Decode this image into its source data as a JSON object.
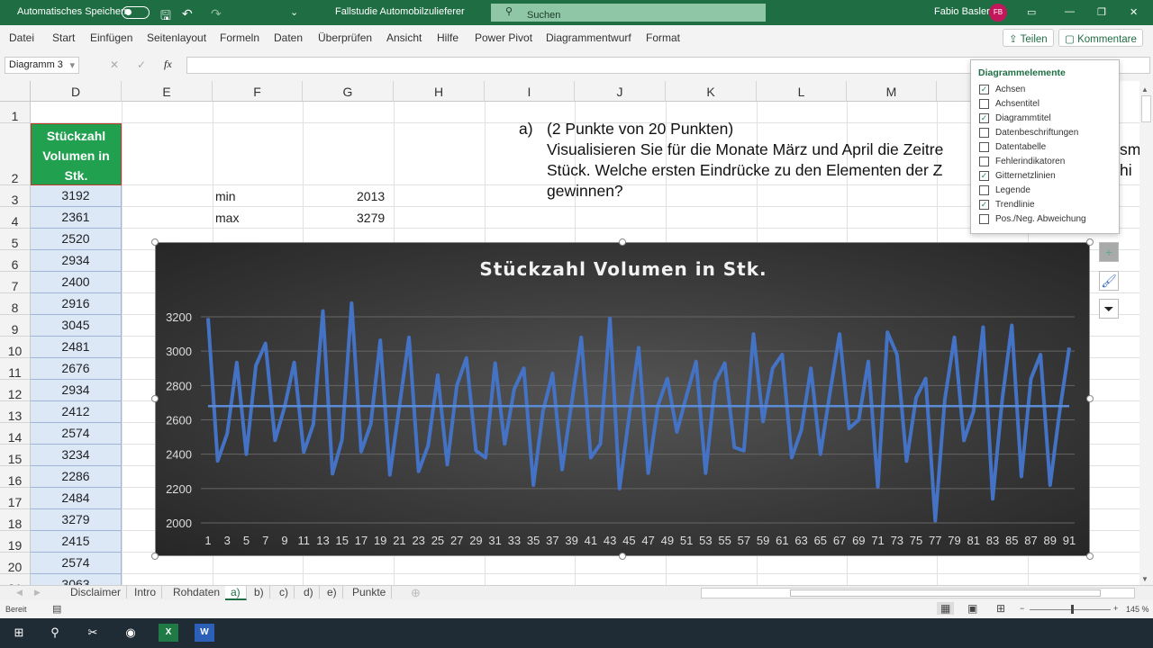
{
  "titlebar": {
    "autosave": "Automatisches Speichern",
    "filename": "Fallstudie Automobilzulieferer",
    "search_placeholder": "Suchen",
    "user": "Fabio Basler",
    "user_initials": "FB"
  },
  "menu": {
    "items": [
      "Datei",
      "Start",
      "Einfügen",
      "Seitenlayout",
      "Formeln",
      "Daten",
      "Überprüfen",
      "Ansicht",
      "Hilfe",
      "Power Pivot",
      "Diagrammentwurf",
      "Format"
    ],
    "share": "Teilen",
    "comments": "Kommentare"
  },
  "formula_bar": {
    "name_box": "Diagramm 3",
    "fx": "fx",
    "value": ""
  },
  "columns": [
    "D",
    "E",
    "F",
    "G",
    "H",
    "I",
    "J",
    "K",
    "L",
    "M",
    "N"
  ],
  "rows": [
    "1",
    "2",
    "3",
    "4",
    "5",
    "6",
    "7",
    "8",
    "9",
    "10",
    "11",
    "12",
    "13",
    "14",
    "15",
    "16",
    "17",
    "18",
    "19",
    "20",
    "21"
  ],
  "column_d": {
    "header": "Stückzahl Volumen in Stk.",
    "values": [
      "3192",
      "2361",
      "2520",
      "2934",
      "2400",
      "2916",
      "3045",
      "2481",
      "2676",
      "2934",
      "2412",
      "2574",
      "3234",
      "2286",
      "2484",
      "3279",
      "2415",
      "2574",
      "3063"
    ]
  },
  "stats": {
    "min_label": "min",
    "min_value": "2013",
    "max_label": "max",
    "max_value": "3279"
  },
  "task": {
    "label": "a)",
    "line1": "(2 Punkte von 20 Punkten)",
    "line2": "Visualisieren Sie für die Monate März und April die Zeitre",
    "line2_end": "sm",
    "line3": "Stück. Welche ersten Eindrücke zu den Elementen der Z",
    "line3_end": "hi",
    "line4": "gewinnen?"
  },
  "chart_elements": {
    "title": "Diagrammelemente",
    "items": [
      {
        "label": "Achsen",
        "checked": true
      },
      {
        "label": "Achsentitel",
        "checked": false
      },
      {
        "label": "Diagrammtitel",
        "checked": true
      },
      {
        "label": "Datenbeschriftungen",
        "checked": false
      },
      {
        "label": "Datentabelle",
        "checked": false
      },
      {
        "label": "Fehlerindikatoren",
        "checked": false
      },
      {
        "label": "Gitternetzlinien",
        "checked": true
      },
      {
        "label": "Legende",
        "checked": false
      },
      {
        "label": "Trendlinie",
        "checked": true
      },
      {
        "label": "Pos./Neg. Abweichung",
        "checked": false
      }
    ]
  },
  "chart_data": {
    "type": "line",
    "title": "Stückzahl Volumen in Stk.",
    "xlabel": "",
    "ylabel": "",
    "ylim": [
      2000,
      3200
    ],
    "yticks": [
      2000,
      2200,
      2400,
      2600,
      2800,
      3000,
      3200
    ],
    "grid": true,
    "legend": "none",
    "line_color": "#4472c4",
    "trendline": {
      "type": "linear",
      "value": 2680
    },
    "x_tick_step": 2,
    "values": [
      3192,
      2361,
      2520,
      2934,
      2400,
      2916,
      3045,
      2481,
      2676,
      2934,
      2412,
      2574,
      3234,
      2286,
      2484,
      3279,
      2415,
      2574,
      3063,
      2280,
      2680,
      3080,
      2300,
      2450,
      2860,
      2340,
      2800,
      2960,
      2420,
      2380,
      2930,
      2460,
      2780,
      2900,
      2220,
      2650,
      2870,
      2310,
      2700,
      3080,
      2380,
      2460,
      3190,
      2200,
      2620,
      3020,
      2290,
      2680,
      2840,
      2530,
      2740,
      2940,
      2290,
      2820,
      2930,
      2440,
      2420,
      3100,
      2590,
      2900,
      2980,
      2380,
      2540,
      2900,
      2400,
      2760,
      3100,
      2550,
      2600,
      2940,
      2210,
      3110,
      2980,
      2360,
      2730,
      2840,
      2013,
      2720,
      3080,
      2480,
      2650,
      3140,
      2140,
      2720,
      3150,
      2270,
      2840,
      2980,
      2220,
      2650,
      3020
    ]
  },
  "sheet_tabs": [
    "Disclaimer",
    "Intro",
    "Rohdaten",
    "a)",
    "b)",
    "c)",
    "d)",
    "e)",
    "Punkte"
  ],
  "active_tab": "a)",
  "status": {
    "text": "Bereit",
    "zoom": "145 %"
  }
}
